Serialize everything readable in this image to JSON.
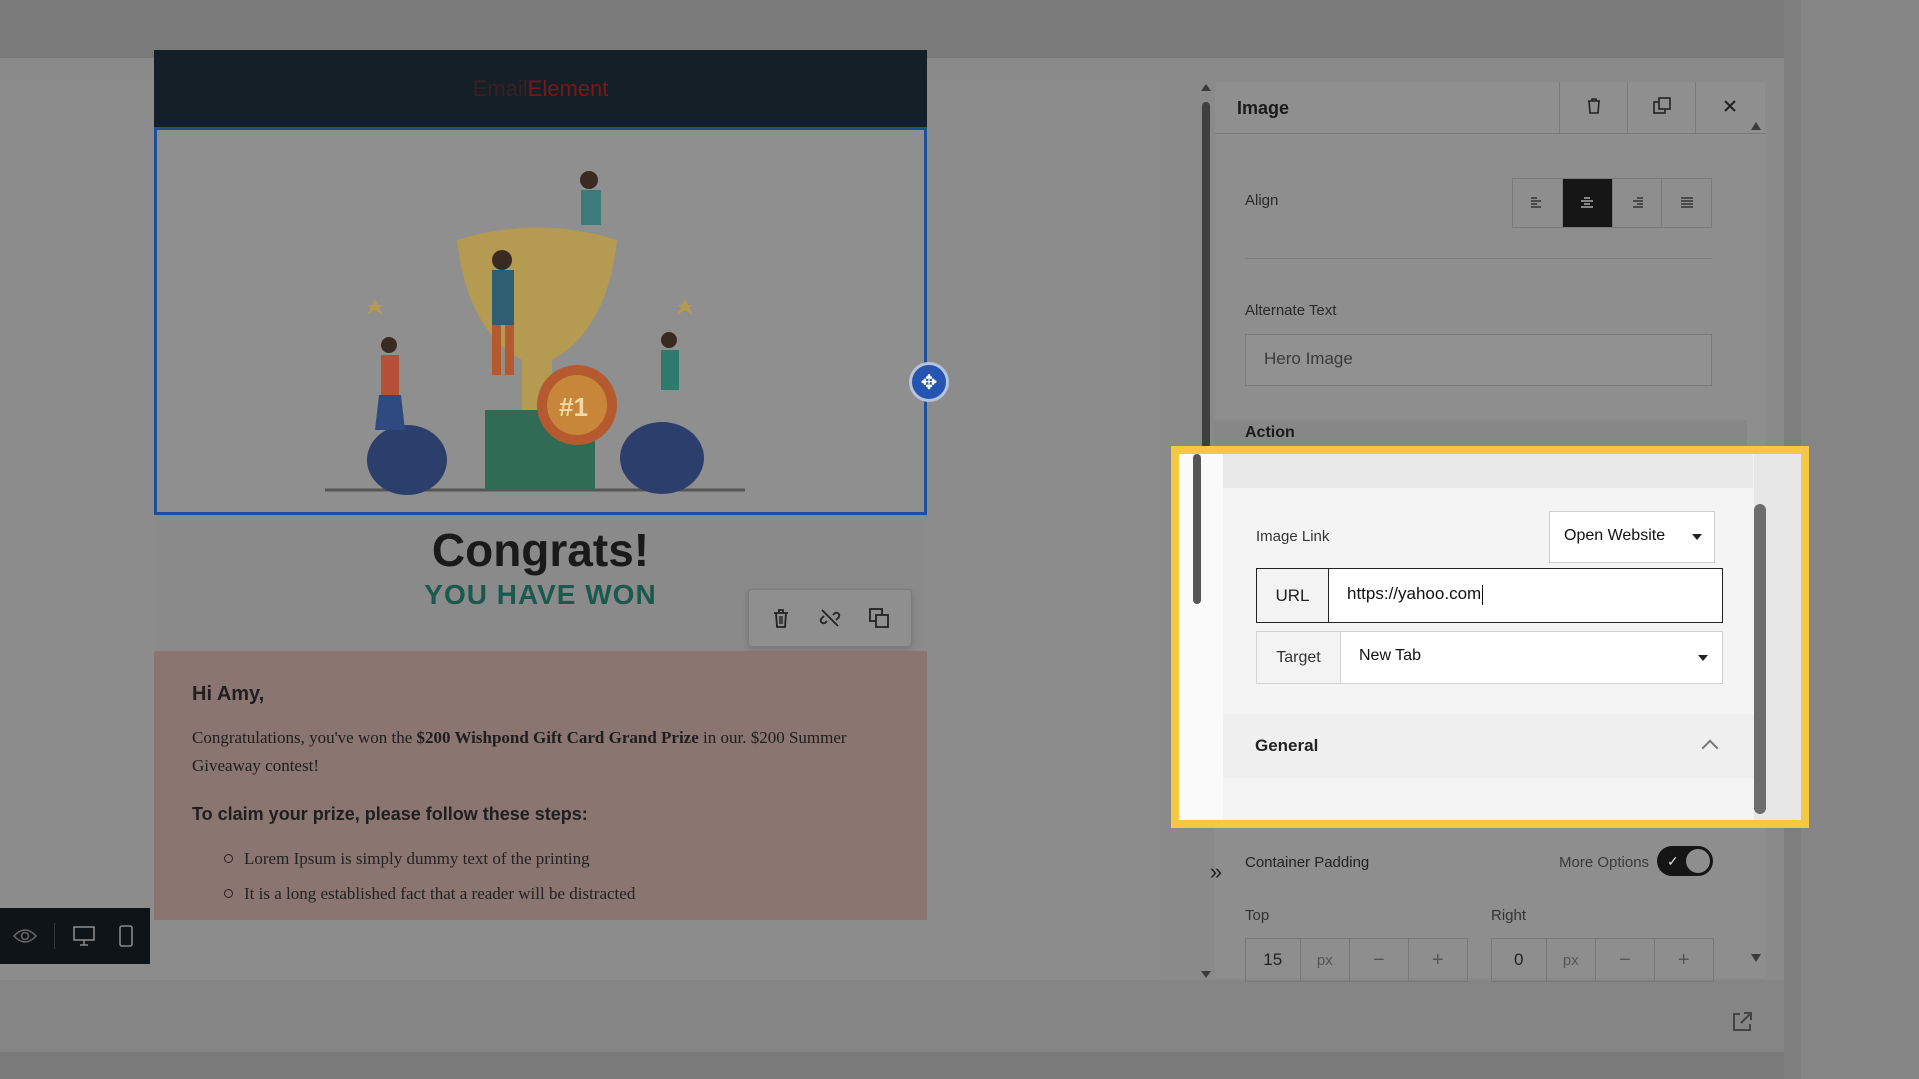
{
  "email": {
    "logo_part1": "Email",
    "logo_part2": "Element",
    "hero_badge": "#1",
    "congrats_title": "Congrats!",
    "congrats_subtitle": "YOU HAVE WON",
    "greeting": "Hi Amy,",
    "para_prefix": "Congratulations, you've won the ",
    "para_bold": "$200 Wishpond Gift Card Grand Prize",
    "para_suffix": " in our. $200 Summer Giveaway contest!",
    "steps_title": "To claim your prize, please follow these steps:",
    "steps": [
      "Lorem Ipsum is simply dummy text of the printing",
      "It is a long established fact that a reader will be distracted"
    ]
  },
  "panel": {
    "title": "Image",
    "align_label": "Align",
    "alt_text_label": "Alternate Text",
    "alt_text_value": "Hero Image",
    "action_label": "Action",
    "image_link_label": "Image Link",
    "image_link_value": "Open Website",
    "url_label": "URL",
    "url_value": "https://yahoo.com",
    "target_label": "Target",
    "target_value": "New Tab",
    "general_label": "General",
    "container_padding_label": "Container Padding",
    "more_options_label": "More Options",
    "top_label": "Top",
    "right_label": "Right",
    "top_value": "15",
    "right_value": "0",
    "unit": "px",
    "minus": "−",
    "plus": "+"
  },
  "colors": {
    "highlight": "#f5c842",
    "selection_blue": "#1e4f9a",
    "teal_subtitle": "#1a5a4e"
  },
  "icons": [
    "trash-icon",
    "duplicate-icon",
    "close-icon",
    "align-left-icon",
    "align-center-icon",
    "align-right-icon",
    "align-justify-icon",
    "move-icon",
    "unlink-icon",
    "copy-icon",
    "eye-icon",
    "desktop-icon",
    "mobile-icon",
    "collapse-icon",
    "external-link-icon"
  ]
}
